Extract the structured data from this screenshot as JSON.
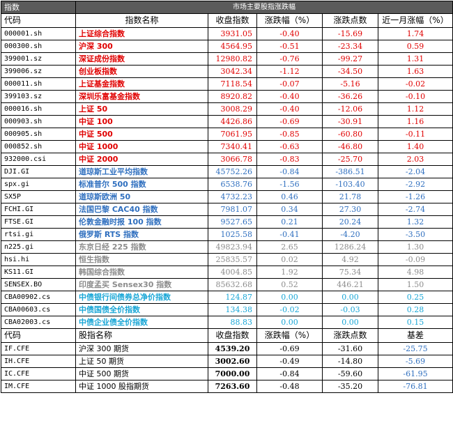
{
  "header": {
    "corner_label": "指数",
    "title": "市场主要股指涨跌幅"
  },
  "columns": [
    "代码",
    "指数名称",
    "收盘指数",
    "涨跌幅（%）",
    "涨跌点数",
    "近一月涨幅（%）"
  ],
  "colors": {
    "red": "#e00000",
    "blue": "#2f6fbf",
    "gray": "#8c8c8c",
    "cyan": "#18a6d6"
  },
  "rows": [
    {
      "code": "000001.sh",
      "name": "上证综合指数",
      "close": "3931.05",
      "pct": "-0.40",
      "pts": "-15.69",
      "month": "1.74",
      "color": "red"
    },
    {
      "code": "000300.sh",
      "name": "沪深 300",
      "close": "4564.95",
      "pct": "-0.51",
      "pts": "-23.34",
      "month": "0.59",
      "color": "red"
    },
    {
      "code": "399001.sz",
      "name": "深证成份指数",
      "close": "12980.82",
      "pct": "-0.76",
      "pts": "-99.27",
      "month": "1.31",
      "color": "red"
    },
    {
      "code": "399006.sz",
      "name": "创业板指数",
      "close": "3042.34",
      "pct": "-1.12",
      "pts": "-34.50",
      "month": "1.63",
      "color": "red"
    },
    {
      "code": "000011.sh",
      "name": "上证基金指数",
      "close": "7118.54",
      "pct": "-0.07",
      "pts": "-5.16",
      "month": "-0.02",
      "color": "red"
    },
    {
      "code": "399103.sz",
      "name": "深圳乐富基金指数",
      "close": "8920.82",
      "pct": "-0.40",
      "pts": "-36.26",
      "month": "-0.10",
      "color": "red"
    },
    {
      "code": "000016.sh",
      "name": "上证 50",
      "close": "3008.29",
      "pct": "-0.40",
      "pts": "-12.06",
      "month": "1.12",
      "color": "red"
    },
    {
      "code": "000903.sh",
      "name": "中证 100",
      "close": "4426.86",
      "pct": "-0.69",
      "pts": "-30.91",
      "month": "1.16",
      "color": "red"
    },
    {
      "code": "000905.sh",
      "name": "中证 500",
      "close": "7061.95",
      "pct": "-0.85",
      "pts": "-60.80",
      "month": "-0.11",
      "color": "red"
    },
    {
      "code": "000852.sh",
      "name": "中证 1000",
      "close": "7340.41",
      "pct": "-0.63",
      "pts": "-46.80",
      "month": "1.40",
      "color": "red"
    },
    {
      "code": "932000.csi",
      "name": "中证 2000",
      "close": "3066.78",
      "pct": "-0.83",
      "pts": "-25.70",
      "month": "2.03",
      "color": "red"
    },
    {
      "code": "DJI.GI",
      "name": "道琼斯工业平均指数",
      "close": "45752.26",
      "pct": "-0.84",
      "pts": "-386.51",
      "month": "-2.04",
      "color": "blue"
    },
    {
      "code": "spx.gi",
      "name": "标准普尔 500 指数",
      "close": "6538.76",
      "pct": "-1.56",
      "pts": "-103.40",
      "month": "-2.92",
      "color": "blue"
    },
    {
      "code": "SX5P",
      "name": "道琼斯欧洲 50",
      "close": "4732.23",
      "pct": "0.46",
      "pts": "21.78",
      "month": "-1.26",
      "color": "blue"
    },
    {
      "code": "FCHI.GI",
      "name": "法国巴黎 CAC40 指数",
      "close": "7981.07",
      "pct": "0.34",
      "pts": "27.30",
      "month": "-2.74",
      "color": "blue"
    },
    {
      "code": "FTSE.GI",
      "name": "伦敦金融时报 100 指数",
      "close": "9527.65",
      "pct": "0.21",
      "pts": "20.24",
      "month": "1.32",
      "color": "blue"
    },
    {
      "code": "rtsi.gi",
      "name": "俄罗斯 RTS 指数",
      "close": "1025.58",
      "pct": "-0.41",
      "pts": "-4.20",
      "month": "-3.50",
      "color": "blue"
    },
    {
      "code": "n225.gi",
      "name": "东京日经 225 指数",
      "close": "49823.94",
      "pct": "2.65",
      "pts": "1286.24",
      "month": "1.30",
      "color": "gray"
    },
    {
      "code": "hsi.hi",
      "name": "恒生指数",
      "close": "25835.57",
      "pct": "0.02",
      "pts": "4.92",
      "month": "-0.09",
      "color": "gray"
    },
    {
      "code": "KS11.GI",
      "name": "韩国综合指数",
      "close": "4004.85",
      "pct": "1.92",
      "pts": "75.34",
      "month": "4.98",
      "color": "gray"
    },
    {
      "code": "SENSEX.BO",
      "name": "印度孟买 Sensex30 指数",
      "close": "85632.68",
      "pct": "0.52",
      "pts": "446.21",
      "month": "1.50",
      "color": "gray"
    },
    {
      "code": "CBA00902.cs",
      "name": "中债银行间债券总净价指数",
      "close": "124.87",
      "pct": "0.00",
      "pts": "0.00",
      "month": "0.25",
      "color": "cyan"
    },
    {
      "code": "CBA00603.cs",
      "name": "中债国债全价指数",
      "close": "134.38",
      "pct": "-0.02",
      "pts": "-0.03",
      "month": "0.28",
      "color": "cyan"
    },
    {
      "code": "CBA02003.cs",
      "name": "中债企业债全价指数",
      "close": "88.83",
      "pct": "0.00",
      "pts": "0.00",
      "month": "0.15",
      "color": "cyan"
    }
  ],
  "futures_columns": [
    "代码",
    "股指名称",
    "收盘指数",
    "涨跌幅（%）",
    "涨跌点数",
    "基差"
  ],
  "futures": [
    {
      "code": "IF.CFE",
      "name": "沪深 300 期货",
      "close": "4539.20",
      "pct": "-0.69",
      "pts": "-31.60",
      "basis": "-25.75"
    },
    {
      "code": "IH.CFE",
      "name": "上证 50 期货",
      "close": "3002.60",
      "pct": "-0.49",
      "pts": "-14.80",
      "basis": "-5.69"
    },
    {
      "code": "IC.CFE",
      "name": "中证 500 期货",
      "close": "7000.00",
      "pct": "-0.84",
      "pts": "-59.60",
      "basis": "-61.95"
    },
    {
      "code": "IM.CFE",
      "name": "中证 1000 股指期货",
      "close": "7263.60",
      "pct": "-0.48",
      "pts": "-35.20",
      "basis": "-76.81"
    }
  ]
}
